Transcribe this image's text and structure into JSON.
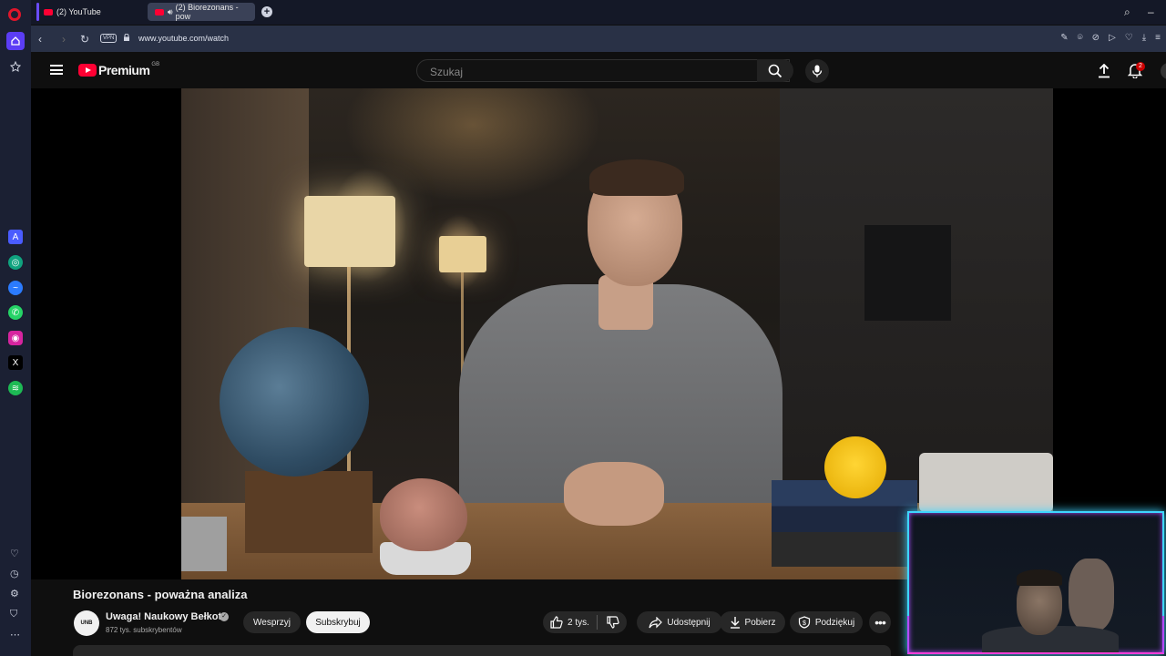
{
  "browser": {
    "tabs": [
      {
        "label": "(2) YouTube"
      },
      {
        "label": "(2) Biorezonans - pow"
      }
    ],
    "url": "www.youtube.com/watch",
    "vpn_label": "VPN"
  },
  "header": {
    "brand": "Premium",
    "country": "GB",
    "search_placeholder": "Szukaj",
    "notification_count": "2"
  },
  "video": {
    "title": "Biorezonans - poważna analiza",
    "channel": {
      "name": "Uwaga! Naukowy Bełkot",
      "avatar_text": "UNB",
      "subscribers": "872 tys. subskrybentów"
    },
    "buttons": {
      "join": "Wesprzyj",
      "subscribe": "Subskrybuj",
      "likes": "2 tys.",
      "share": "Udostępnij",
      "download": "Pobierz",
      "thanks": "Podziękuj"
    }
  },
  "colors": {
    "accent": "#ff0033",
    "opera": "#e0162b",
    "webcam_border": "#3fd6ff"
  }
}
